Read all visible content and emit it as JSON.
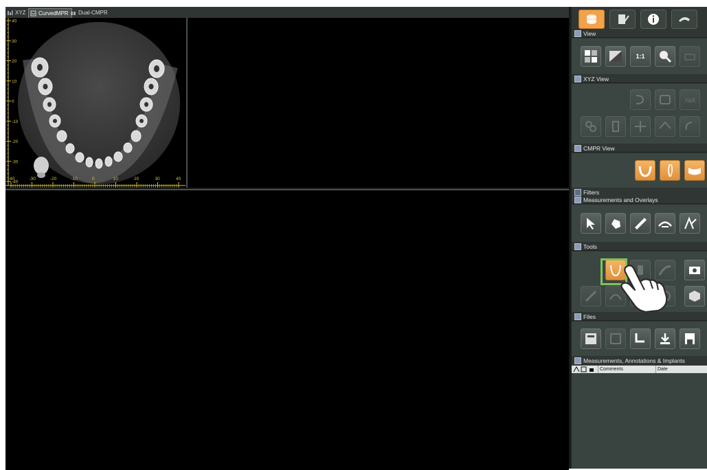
{
  "tabs": [
    {
      "label": "XYZ",
      "icon": "xyz-icon",
      "active": false
    },
    {
      "label": "CurvedMPR",
      "icon": "curved-mpr-icon",
      "active": true
    },
    {
      "label": "Dual-CMPR",
      "icon": "dual-cmpr-icon",
      "active": false
    }
  ],
  "axial_view": {
    "y_ticks": [
      "40",
      "30",
      "20",
      "10",
      "0",
      "-10",
      "-20",
      "-30",
      "-40"
    ],
    "x_ticks": [
      "-40",
      "-30",
      "-20",
      "-10",
      "0",
      "10",
      "20",
      "30",
      "40"
    ],
    "ruler_color": "#d6c240"
  },
  "panel": {
    "top_tabs": [
      {
        "icon": "database-icon",
        "active": true
      },
      {
        "icon": "edit-icon",
        "active": false
      },
      {
        "icon": "info-icon",
        "active": false
      },
      {
        "icon": "settings-icon",
        "active": false
      }
    ],
    "sections": {
      "view": "View",
      "xyz_view": "XYZ View",
      "cmpr_view": "CMPR View",
      "filters": "Filters",
      "measurements_overlays": "Measurements and Overlays",
      "tools": "Tools",
      "files": "Files",
      "measurements_annotations": "Measurements, Annotations & Implants"
    },
    "view_buttons": [
      {
        "icon": "layout-icon"
      },
      {
        "icon": "contrast-icon"
      },
      {
        "icon": "actual-size-icon",
        "text": "1:1"
      },
      {
        "icon": "zoom-icon"
      },
      {
        "icon": "disabled-icon"
      }
    ],
    "list_columns": [
      "Comments",
      "Date"
    ]
  },
  "colors": {
    "accent": "#f2a24b",
    "highlight": "#7fc35a",
    "panel_bg": "#2f3633"
  }
}
